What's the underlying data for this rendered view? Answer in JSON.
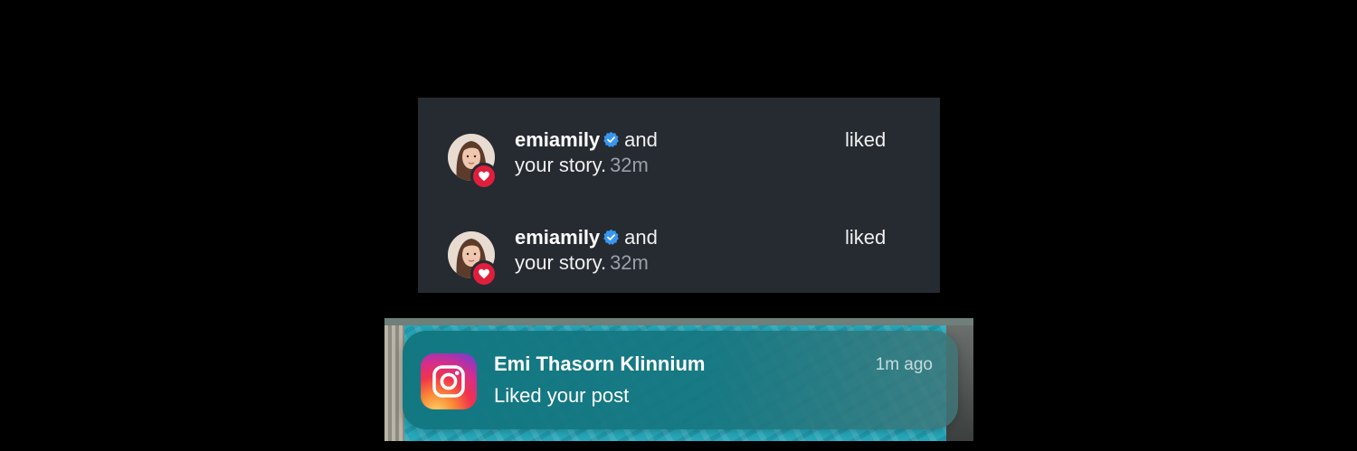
{
  "activity": {
    "items": [
      {
        "username": "emiamily",
        "connector": "and",
        "action": "liked",
        "object": "your story.",
        "time": "32m",
        "verified": true
      },
      {
        "username": "emiamily",
        "connector": "and",
        "action": "liked",
        "object": "your story.",
        "time": "32m",
        "verified": true
      }
    ],
    "icons": {
      "verified": "verified-badge-icon",
      "like": "heart-icon"
    },
    "colors": {
      "panel_bg": "#262a31",
      "verified": "#3797f0",
      "like_badge": "#e01f3d",
      "time_text": "#9aa0a8"
    }
  },
  "notification": {
    "app_icon": "instagram-icon",
    "title": "Emi Thasorn Klinnium",
    "time": "1m ago",
    "body": "Liked your post",
    "colors": {
      "card_bg": "#117680",
      "background_water": "#27a8ba"
    }
  }
}
